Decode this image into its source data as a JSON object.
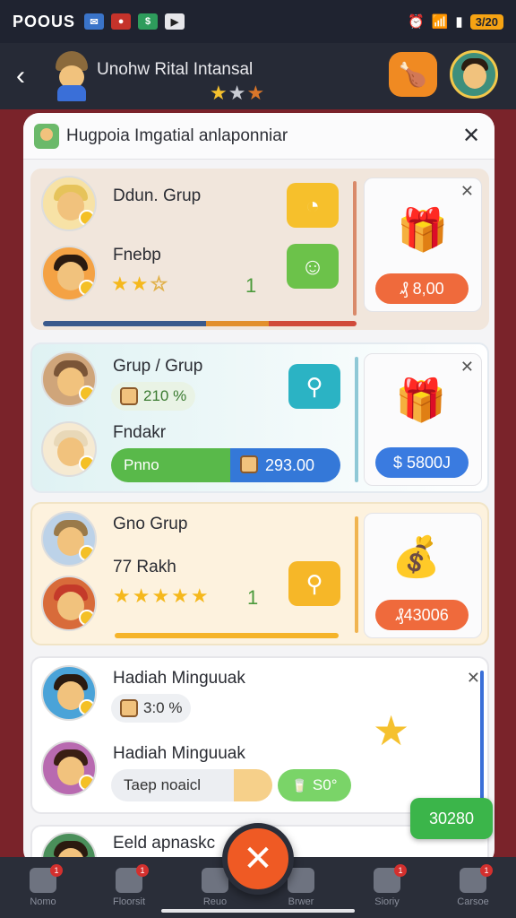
{
  "status_bar": {
    "carrier": "POOUS",
    "battery": "3/20"
  },
  "header": {
    "title": "Unohw Rital Intansal",
    "stars": [
      "★",
      "★",
      "★"
    ]
  },
  "sheet": {
    "title": "Hugpoia Imgatial anlaponniar"
  },
  "cards": [
    {
      "name1": "Ddun. Grup",
      "name2": "Fnebp",
      "stars_filled": "★★",
      "stars_empty": "☆",
      "count": "1",
      "price": "₰ 8,00"
    },
    {
      "name1": "Grup / Grup",
      "pct": "210 %",
      "name2": "Fndakr",
      "bar_label": "Pnno",
      "bar_value": "293.00",
      "price": "$ 5800J"
    },
    {
      "name1": "Gno Grup",
      "name2": "77 Rakh",
      "stars": "★★★★★",
      "count": "1",
      "price": "₰43006"
    },
    {
      "name1": "Hadiah Minguuak",
      "pct": "3:0 %",
      "name2": "Hadiah Minguuak",
      "input_value": "Taep noaicl",
      "chip": "S0°"
    },
    {
      "name1": "Eeld apnaskc"
    }
  ],
  "floating_chip": "30280",
  "nav": [
    {
      "label": "Nomo",
      "badge": "1"
    },
    {
      "label": "Floorsit",
      "badge": "1"
    },
    {
      "label": "Reuo",
      "badge": ""
    },
    {
      "label": "Brwer",
      "badge": ""
    },
    {
      "label": "Sioriy",
      "badge": "1"
    },
    {
      "label": "Carsoe",
      "badge": "1"
    }
  ],
  "colors": {
    "accent_orange": "#f08a22",
    "fab": "#ef5a24",
    "green": "#3bb54a",
    "backdrop": "#7a232a"
  }
}
